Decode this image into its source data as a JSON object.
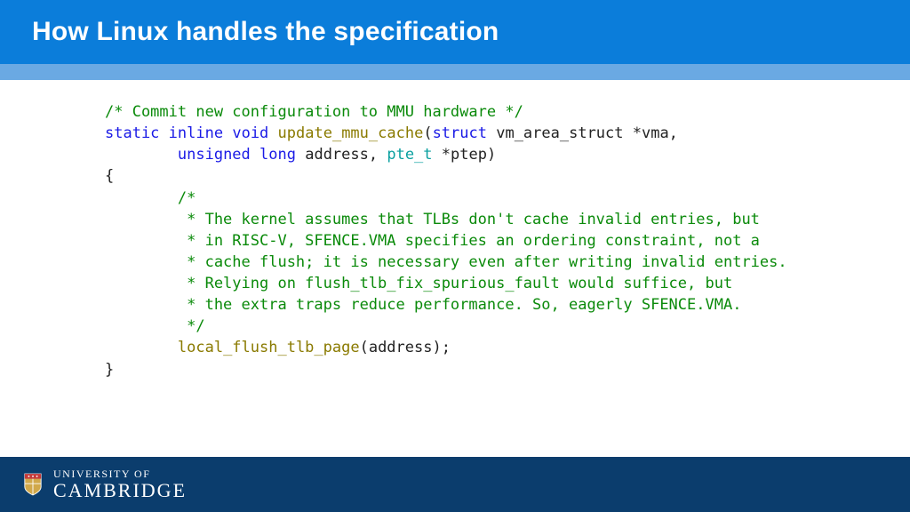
{
  "title": "How Linux handles the specification",
  "code": {
    "c1": "/* Commit new configuration to MMU hardware */",
    "kw_static": "static",
    "kw_inline": "inline",
    "kw_void": "void",
    "fn1": "update_mmu_cache",
    "p1": "(",
    "kw_struct": "struct",
    "id1": " vm_area_struct *vma,",
    "indent1": "        ",
    "kw_unsigned": "unsigned",
    "kw_long": "long",
    "id2": " address, ",
    "ty1": "pte_t",
    "id3": " *ptep)",
    "brace_open": "{",
    "cm_l1": "        /*",
    "cm_l2": "         * The kernel assumes that TLBs don't cache invalid entries, but",
    "cm_l3": "         * in RISC-V, SFENCE.VMA specifies an ordering constraint, not a",
    "cm_l4": "         * cache flush; it is necessary even after writing invalid entries.",
    "cm_l5": "         * Relying on flush_tlb_fix_spurious_fault would suffice, but",
    "cm_l6": "         * the extra traps reduce performance. So, eagerly SFENCE.VMA.",
    "cm_l7": "         */",
    "indent2": "        ",
    "fn2": "local_flush_tlb_page",
    "call_tail": "(address);",
    "brace_close": "}"
  },
  "footer": {
    "uni_top": "UNIVERSITY OF",
    "uni_bot": "CAMBRIDGE"
  }
}
